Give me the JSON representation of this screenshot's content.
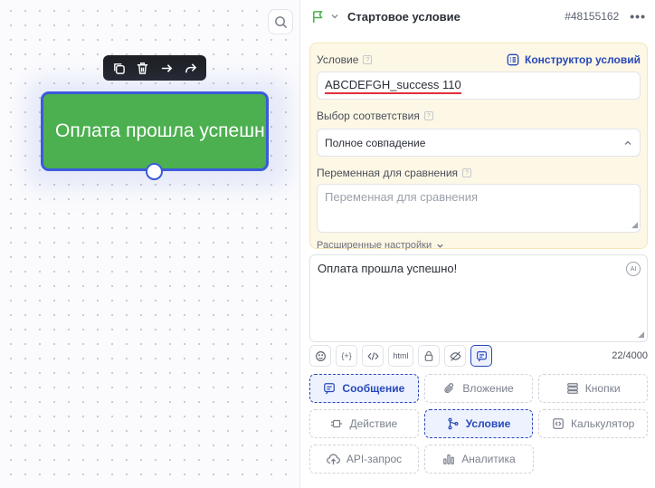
{
  "canvas": {
    "node": {
      "title": "Оплата прошла успешн"
    }
  },
  "panel": {
    "header": {
      "title": "Стартовое условие",
      "node_id": "#48155162",
      "more": "•••"
    },
    "condition": {
      "label": "Условие",
      "help": "?",
      "builder_link": "Конструктор условий",
      "value": "ABCDEFGH_success 110"
    },
    "match": {
      "label": "Выбор соответствия",
      "help": "?",
      "selected": "Полное совпадение"
    },
    "compare_var": {
      "label": "Переменная для сравнения",
      "help": "?",
      "placeholder": "Переменная для сравнения"
    },
    "advanced_label": "Расширенные настройки",
    "message": {
      "text": "Оплата прошла успешно!",
      "ai_label": "AI",
      "counter": "22/4000"
    },
    "format_bar": {
      "variable_label": "{+}",
      "html_label": "html"
    },
    "types": [
      {
        "label": "Сообщение",
        "icon": "message-icon",
        "active": true
      },
      {
        "label": "Вложение",
        "icon": "paperclip-icon",
        "active": false
      },
      {
        "label": "Кнопки",
        "icon": "buttons-icon",
        "active": false
      },
      {
        "label": "Действие",
        "icon": "action-icon",
        "active": false
      },
      {
        "label": "Условие",
        "icon": "branch-icon",
        "active": true
      },
      {
        "label": "Калькулятор",
        "icon": "calculator-icon",
        "active": false
      },
      {
        "label": "API-запрос",
        "icon": "cloud-upload-icon",
        "active": false
      },
      {
        "label": "Аналитика",
        "icon": "chart-icon",
        "active": false
      }
    ],
    "colors": {
      "accent": "#2748b8",
      "node_green": "#4caf50",
      "condition_bg": "#fdf7e5"
    }
  }
}
